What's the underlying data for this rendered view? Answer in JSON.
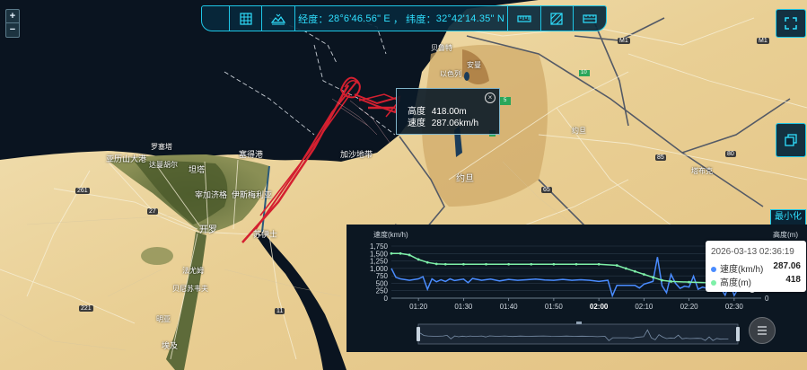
{
  "map": {
    "places": {
      "alexandria": "亚历山大港",
      "rosetta": "罗塞塔",
      "damanhur": "达曼胡尔",
      "tanta": "坦塔",
      "zagazig": "宰加济格",
      "ismailia": "伊斯梅利亚",
      "port_said": "塞得港",
      "cairo": "开罗",
      "suez": "苏伊士",
      "beni_suef": "贝尼苏韦夫",
      "minya_west": "法尤姆",
      "minya": "明亚",
      "gaza": "加沙地带",
      "israel": "以色列",
      "amman": "安曼",
      "jordan": "约旦",
      "jordan2": "约旦",
      "saudi": "塔布克",
      "beirut": "贝鲁特",
      "egypt": "埃及"
    },
    "road_numbers": [
      "261",
      "27",
      "221",
      "11",
      "10",
      "65",
      "85",
      "80",
      "M1",
      "M1",
      "5"
    ]
  },
  "zoom": {
    "in": "+",
    "out": "−"
  },
  "toolbar": {
    "longitude_label": "经度：",
    "longitude_value": "28°6'46.56\" E",
    "separator": "，",
    "latitude_label": "纬度：",
    "latitude_value": "32°42'14.35\" N"
  },
  "popup": {
    "altitude_label": "高度",
    "altitude_value": "418.00m",
    "speed_label": "速度",
    "speed_value": "287.06km/h",
    "close": "×"
  },
  "minimize_label": "最小化",
  "colors": {
    "accent": "#1ec6e6",
    "speed": "#4a8cff",
    "altitude": "#7ef0a8",
    "track": "#d42030"
  },
  "chart_data": {
    "type": "line",
    "y_left_label": "速度(km/h)",
    "y_right_label": "高度(m)",
    "y_left_ticks": [
      "0",
      "250",
      "500",
      "750",
      "1,000",
      "1,250",
      "1,500",
      "1,750"
    ],
    "y_right_ticks": [
      "0",
      "1,000"
    ],
    "ylim_left": [
      0,
      1750
    ],
    "x_ticks": [
      "01:20",
      "01:30",
      "01:40",
      "01:50",
      "02:00",
      "02:10",
      "02:20",
      "02:30"
    ],
    "x_ticks_bold": [
      false,
      false,
      false,
      false,
      true,
      false,
      false,
      false
    ],
    "xlim_minutes": [
      74,
      156
    ],
    "series": [
      {
        "name": "速度(km/h)",
        "color": "#4a8cff",
        "points": [
          [
            74,
            1000
          ],
          [
            75,
            700
          ],
          [
            76,
            650
          ],
          [
            78,
            600
          ],
          [
            80,
            650
          ],
          [
            81,
            720
          ],
          [
            82,
            300
          ],
          [
            83,
            650
          ],
          [
            84,
            550
          ],
          [
            85,
            620
          ],
          [
            86,
            560
          ],
          [
            87,
            650
          ],
          [
            88,
            590
          ],
          [
            90,
            640
          ],
          [
            91,
            520
          ],
          [
            92,
            660
          ],
          [
            94,
            600
          ],
          [
            96,
            640
          ],
          [
            98,
            580
          ],
          [
            100,
            630
          ],
          [
            102,
            600
          ],
          [
            104,
            620
          ],
          [
            106,
            640
          ],
          [
            108,
            610
          ],
          [
            110,
            600
          ],
          [
            112,
            630
          ],
          [
            114,
            600
          ],
          [
            116,
            620
          ],
          [
            118,
            600
          ],
          [
            120,
            560
          ],
          [
            122,
            600
          ],
          [
            123,
            80
          ],
          [
            124,
            430
          ],
          [
            126,
            430
          ],
          [
            128,
            430
          ],
          [
            129,
            340
          ],
          [
            130,
            470
          ],
          [
            132,
            560
          ],
          [
            133,
            1380
          ],
          [
            134,
            420
          ],
          [
            135,
            180
          ],
          [
            136,
            800
          ],
          [
            137,
            500
          ],
          [
            138,
            330
          ],
          [
            139,
            400
          ],
          [
            140,
            370
          ],
          [
            141,
            740
          ],
          [
            142,
            300
          ],
          [
            143,
            370
          ],
          [
            144,
            330
          ],
          [
            146,
            360
          ],
          [
            147,
            340
          ],
          [
            148,
            100
          ],
          [
            149,
            520
          ],
          [
            150,
            90
          ],
          [
            151,
            350
          ],
          [
            152,
            250
          ],
          [
            153,
            270
          ],
          [
            154,
            287
          ]
        ]
      },
      {
        "name": "高度(m)",
        "color": "#7ef0a8",
        "points": [
          [
            74,
            1500
          ],
          [
            76,
            1500
          ],
          [
            78,
            1450
          ],
          [
            80,
            1300
          ],
          [
            82,
            1200
          ],
          [
            84,
            1150
          ],
          [
            86,
            1140
          ],
          [
            90,
            1140
          ],
          [
            95,
            1140
          ],
          [
            100,
            1140
          ],
          [
            105,
            1140
          ],
          [
            110,
            1140
          ],
          [
            115,
            1140
          ],
          [
            120,
            1140
          ],
          [
            124,
            1100
          ],
          [
            126,
            1000
          ],
          [
            128,
            900
          ],
          [
            130,
            800
          ],
          [
            132,
            700
          ],
          [
            134,
            600
          ],
          [
            136,
            560
          ],
          [
            140,
            540
          ],
          [
            144,
            520
          ],
          [
            148,
            500
          ],
          [
            150,
            450
          ],
          [
            152,
            430
          ],
          [
            154,
            418
          ]
        ]
      }
    ],
    "tooltip": {
      "time": "2026-03-13 02:36:19",
      "speed_label": "速度(km/h)",
      "speed_value": "287.06",
      "altitude_label": "高度(m)",
      "altitude_value": "418"
    }
  }
}
